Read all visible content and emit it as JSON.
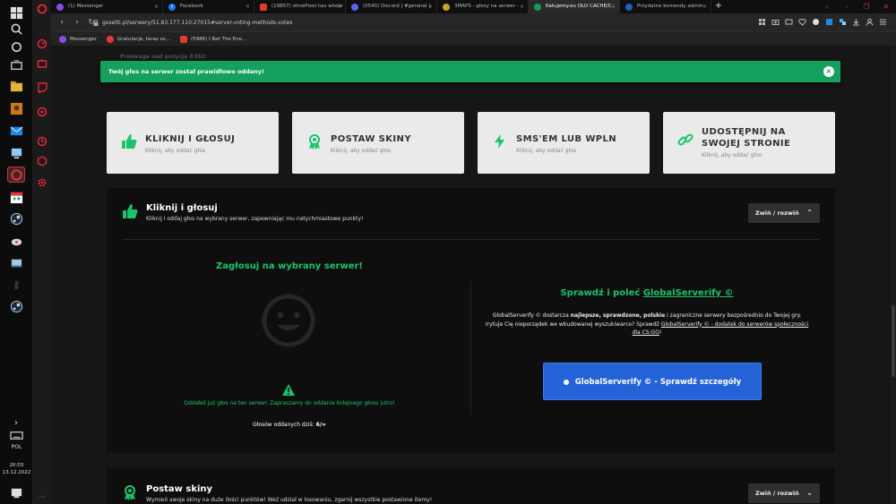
{
  "tabs": [
    {
      "label": "(1) Messenger",
      "icon_color": "#8a4ce6",
      "icon": "messenger-icon"
    },
    {
      "label": "Facebook",
      "icon_color": "#1877f2",
      "icon": "facebook-icon"
    },
    {
      "label": "(19857) ohnePixel has whole",
      "icon_color": "#e53935",
      "icon": "youtube-icon"
    },
    {
      "label": "(0540) Discord | #general |",
      "icon_color": "#5865f2",
      "icon": "discord-icon"
    },
    {
      "label": "3MAPS - głosy na serwer -",
      "icon_color": "#c9a227",
      "icon": "gosetti-icon"
    },
    {
      "label": "Katujemy.eu OLD CACHE/C",
      "icon_color": "#1a9a5a",
      "icon": "katujemy-icon"
    },
    {
      "label": "Przydatne komendy admin",
      "icon_color": "#1565c0",
      "icon": "site-icon"
    }
  ],
  "active_tab": 5,
  "address": {
    "url": "gosetti.pl/serwery/51.83.177.110:27015#server-voting-methods-votes"
  },
  "bookmarks": [
    {
      "label": "Messenger",
      "color": "#8a4ce6"
    },
    {
      "label": "Gratulacje, teraz os...",
      "color": "#e53935"
    },
    {
      "label": "(5986) I Bet The Ene...",
      "color": "#e53935"
    }
  ],
  "taskbar": {
    "lang": "POL",
    "time": "20:03",
    "date": "13.12.2022"
  },
  "ghost_text": "Przewaga nad pozycją #262:",
  "alert": {
    "text": "Twój głos na serwer został prawidłowo oddany!",
    "close": "×",
    "color": "#14a05f"
  },
  "cards": [
    {
      "title": "KLIKNIJ I GŁOSUJ",
      "subtitle": "Kliknij, aby oddać głos",
      "icon": "thumbs-up-icon"
    },
    {
      "title": "POSTAW SKINY",
      "subtitle": "Kliknij, aby oddać głos",
      "icon": "award-icon"
    },
    {
      "title": "SMS'EM LUB WPLN",
      "subtitle": "Kliknij, aby oddać głos",
      "icon": "bolt-icon"
    },
    {
      "title": "UDOSTĘPNIJ NA SWOJEJ STRONIE",
      "subtitle": "Kliknij, aby oddać głos",
      "icon": "link-icon"
    }
  ],
  "panel1": {
    "title": "Kliknij i głosuj",
    "subtitle": "Kliknij i oddaj głos na wybrany serwer, zapewniając mu natychmiastowe punkty!",
    "toggle_label": "Zwiń / rozwiń",
    "left_heading": "Zagłosuj na wybrany serwer!",
    "already_voted": "Oddałeś już głos na ten serwer. Zapraszamy do oddania kolejnego głosu jutro!",
    "votes_label": "Głosów oddanych dziś:",
    "votes_value": "6/∞",
    "right_heading_prefix": "Sprawdź i poleć",
    "right_heading_link": "GlobalServerify ©",
    "desc_1": "GlobalServerify © dostarcza",
    "desc_bold": "najlepsze, sprawdzone, polskie",
    "desc_2": "i zagraniczne serwery bezpośrednio do Twojej gry.",
    "desc_3": "Irytuje Cię nieporządek we wbudowanej wyszukiwarce? Sprawdź",
    "desc_link": "GlobalServerify © - dodatek do serwerów społeczności dla CS:GO",
    "desc_end": "!",
    "button_label": "GlobalServerify © - Sprawdź szczegóły",
    "accent": "#19c46c",
    "button_color": "#2462d8"
  },
  "panel2": {
    "title": "Postaw skiny",
    "subtitle": "Wymień swoje skiny na duże ilości punktów! Weź udział w losowaniu, zgarnij wszystkie postawione itemy!",
    "toggle_label": "Zwiń / rozwiń"
  }
}
